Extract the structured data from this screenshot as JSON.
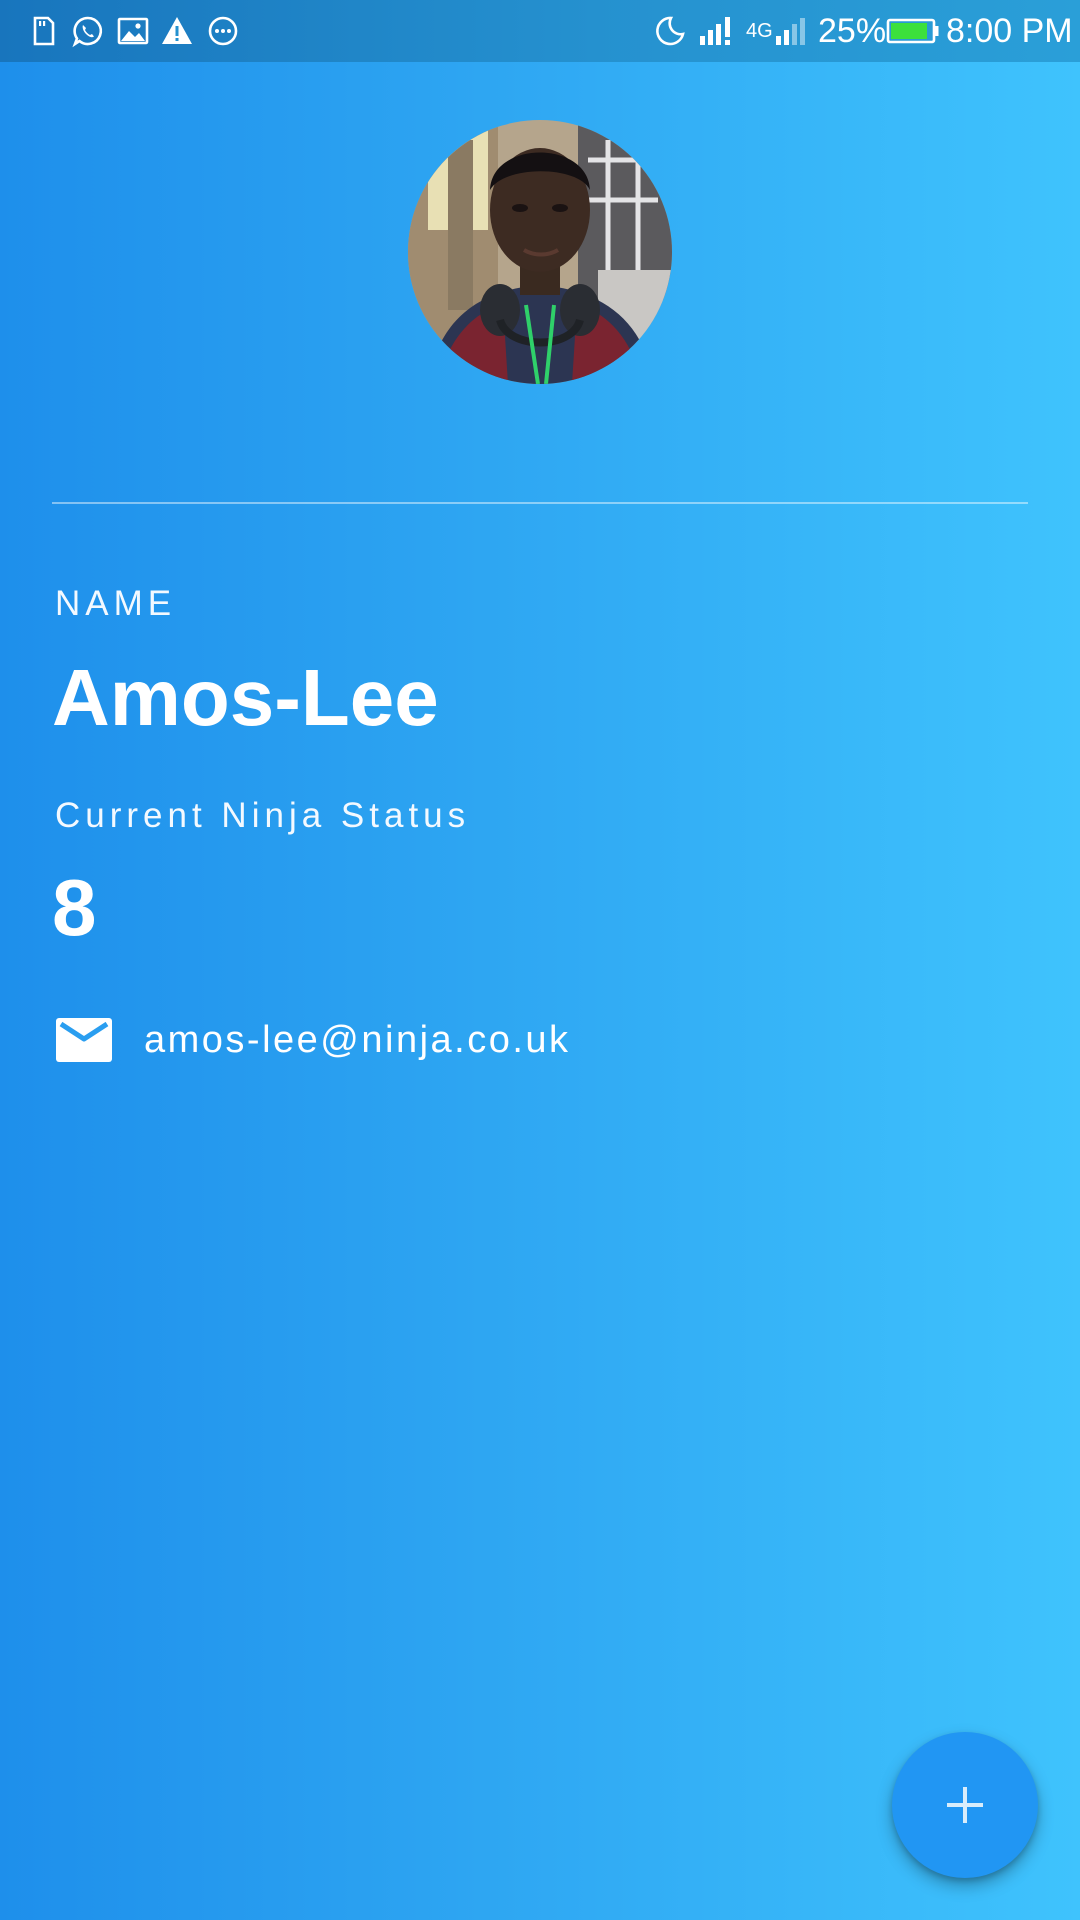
{
  "status_bar": {
    "notification_icons": [
      "sd-card-icon",
      "whatsapp-icon",
      "image-icon",
      "warning-icon",
      "more-horiz-circle-icon"
    ],
    "system_icons": [
      "moon-icon",
      "signal-icon",
      "network-4g-icon",
      "battery-icon"
    ],
    "network_label": "4G",
    "battery_percent": "25%",
    "battery_level": 0.25,
    "time": "8:00 PM"
  },
  "profile": {
    "avatar": "profile-photo",
    "name_label": "NAME",
    "name": "Amos-Lee",
    "status_label": "Current Ninja Status",
    "status_value": "8",
    "email": "amos-lee@ninja.co.uk",
    "email_icon": "mail-icon"
  },
  "fab": {
    "icon": "plus-icon"
  },
  "colors": {
    "gradient_start": "#1E8FEB",
    "gradient_end": "#3FC3FD",
    "fab": "#2196F3",
    "battery_fill": "#3CE03C",
    "text": "#FFFFFF"
  }
}
